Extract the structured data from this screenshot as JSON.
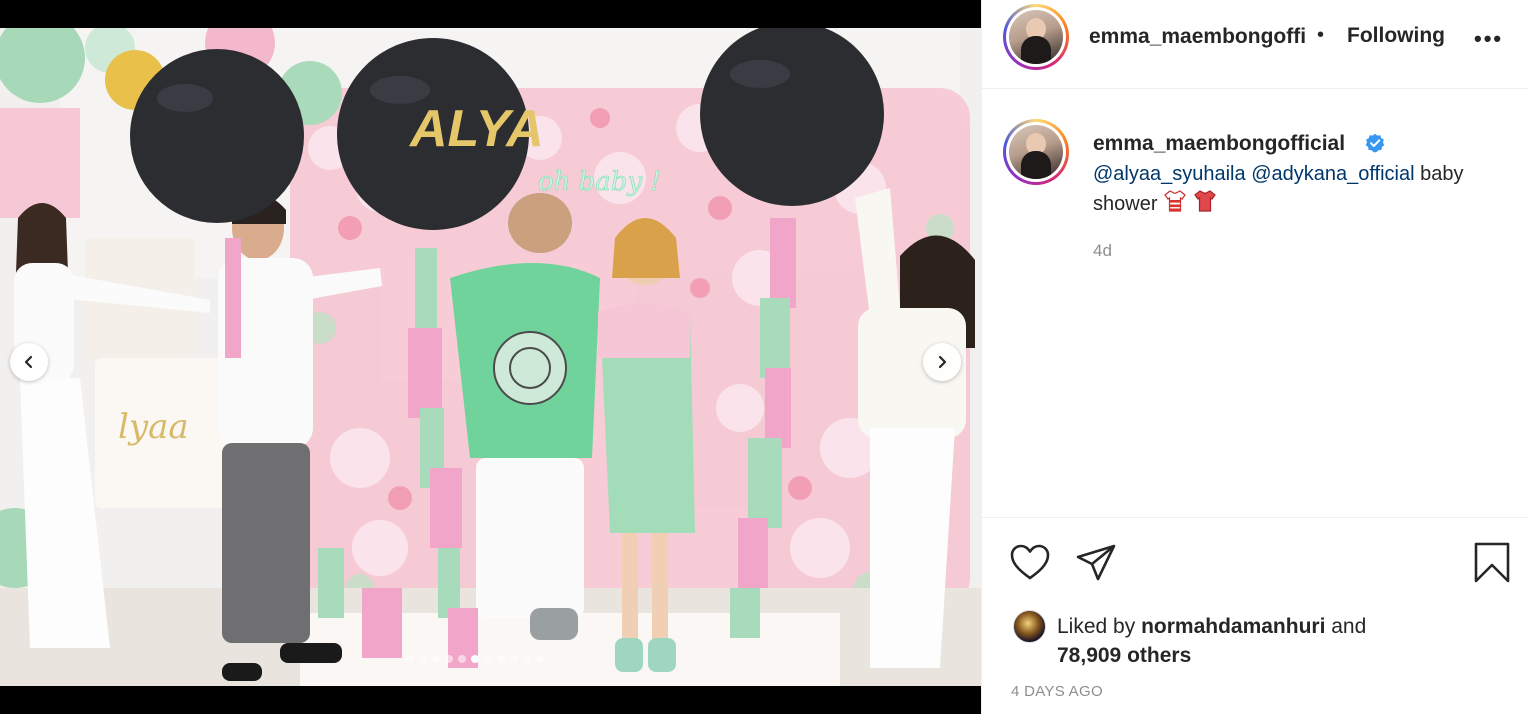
{
  "post": {
    "image_balloon_text": "ALYA",
    "image_neon_text": "oh baby !",
    "image_sign_text": "lyaa",
    "carousel": {
      "total_slides": 11,
      "active_index": 5
    }
  },
  "header": {
    "username": "emma_maembongoffi",
    "separator": "•",
    "follow_label": "Following",
    "more_label": "•••"
  },
  "caption": {
    "username": "emma_maembongofficial",
    "mention_1": "@alyaa_syuhaila",
    "mention_2": "@adykana_official",
    "text": " baby shower ",
    "time": "4d"
  },
  "likes": {
    "prefix": "Liked by ",
    "liker": "normahdamanhuri",
    "conjunction": " and",
    "others": "78,909 others"
  },
  "date": "4 DAYS AGO",
  "icons": [
    "heart-icon",
    "share-icon",
    "bookmark-icon",
    "chevron-left-icon",
    "chevron-right-icon",
    "verified-badge-icon",
    "shirt-emoji-icon"
  ],
  "colors": {
    "mention": "#00376b",
    "verified": "#3897f0",
    "muted": "#8e8e8e",
    "text": "#262626"
  }
}
